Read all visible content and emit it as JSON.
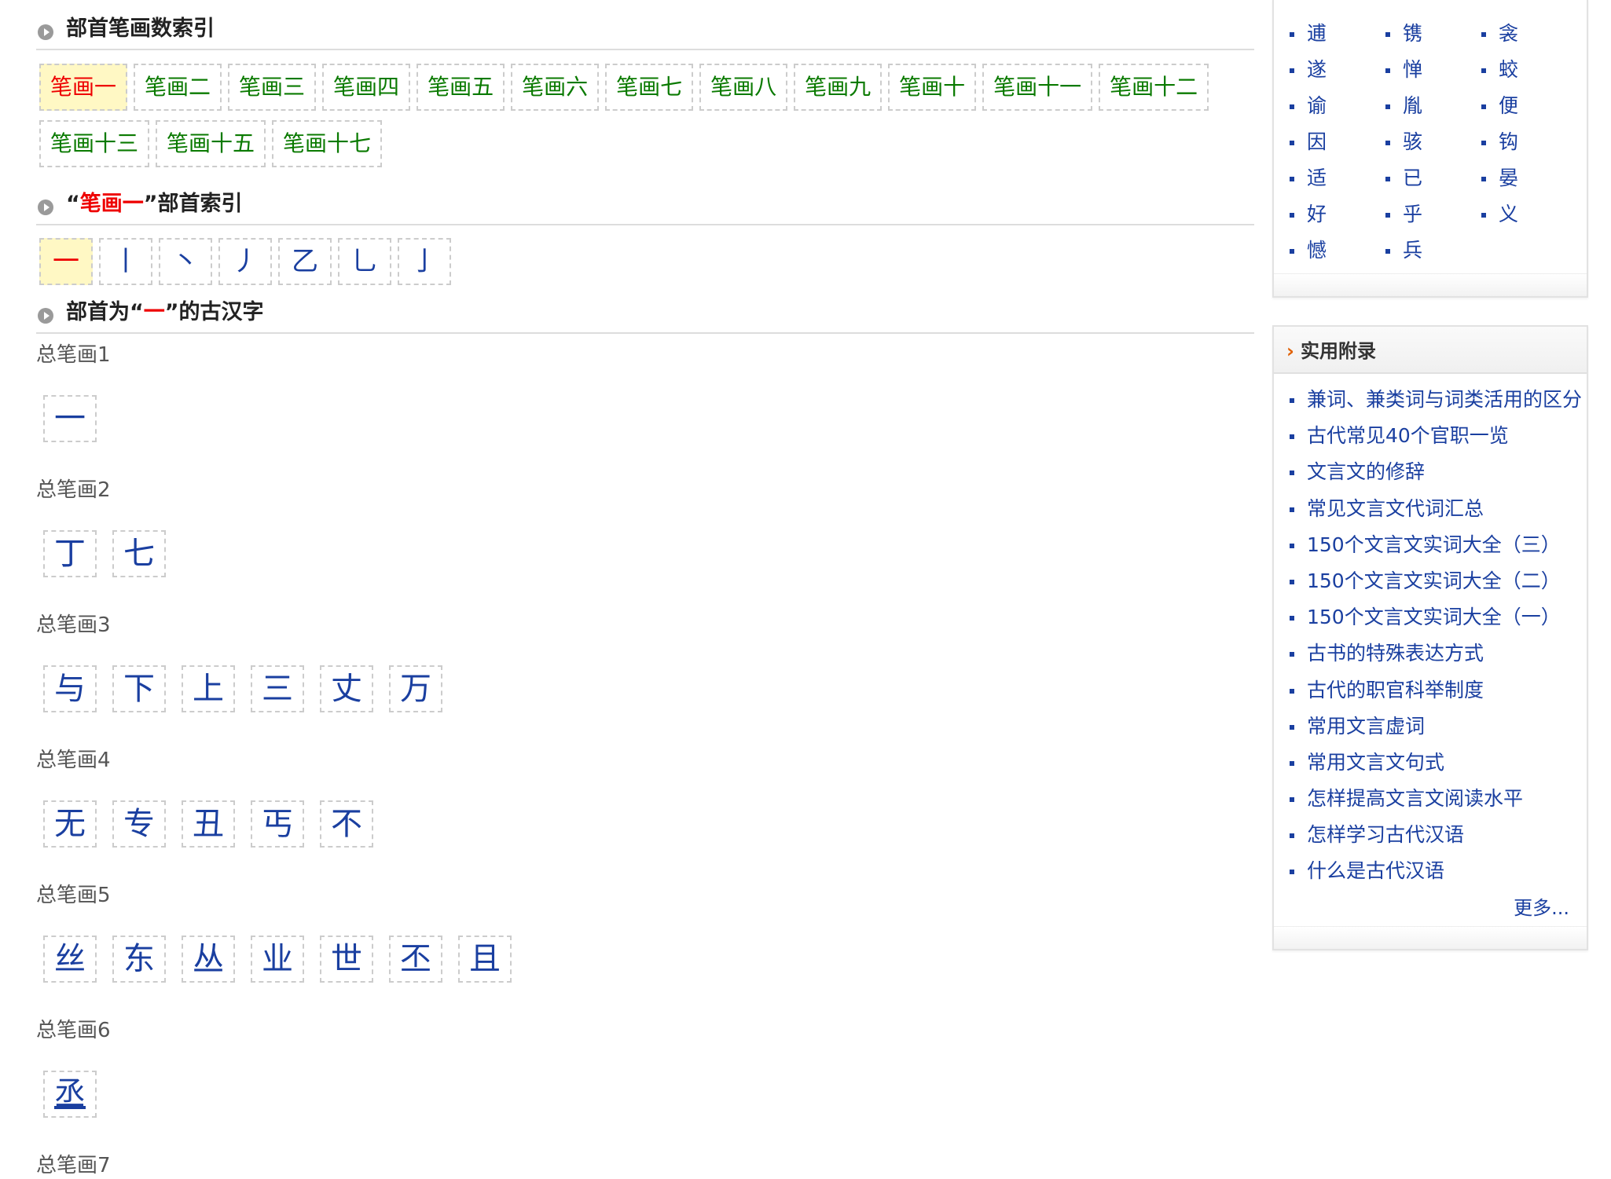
{
  "sections": {
    "stroke_index_title": "部首笔画数索引",
    "radical_index_title_pre": "“",
    "radical_index_title_red": "笔画一",
    "radical_index_title_post": "”部首索引",
    "chars_title_pre": "部首为“",
    "chars_title_red": "一",
    "chars_title_post": "”的古汉字"
  },
  "stroke_buttons": [
    "笔画一",
    "笔画二",
    "笔画三",
    "笔画四",
    "笔画五",
    "笔画六",
    "笔画七",
    "笔画八",
    "笔画九",
    "笔画十",
    "笔画十一",
    "笔画十二",
    "笔画十三",
    "笔画十五",
    "笔画十七"
  ],
  "radicals": [
    "一",
    "丨",
    "丶",
    "丿",
    "乙",
    "乚",
    "亅"
  ],
  "char_groups": [
    {
      "label": "总笔画1",
      "chars": [
        "一"
      ]
    },
    {
      "label": "总笔画2",
      "chars": [
        "丁",
        "七"
      ]
    },
    {
      "label": "总笔画3",
      "chars": [
        "与",
        "下",
        "上",
        "三",
        "丈",
        "万"
      ]
    },
    {
      "label": "总笔画4",
      "chars": [
        "无",
        "专",
        "丑",
        "丐",
        "不"
      ]
    },
    {
      "label": "总笔画5",
      "chars": [
        "丝",
        "东",
        "丛",
        "业",
        "世",
        "丕",
        "且"
      ]
    },
    {
      "label": "总笔画6",
      "chars": [
        "丞"
      ]
    },
    {
      "label": "总笔画7",
      "chars": []
    }
  ],
  "sidebar": {
    "word_grid": [
      [
        "逋",
        "镌",
        "衾"
      ],
      [
        "遂",
        "惮",
        "蛟"
      ],
      [
        "谕",
        "胤",
        "便"
      ],
      [
        "因",
        "骇",
        "钩"
      ],
      [
        "适",
        "已",
        "晏"
      ],
      [
        "好",
        "乎",
        "义"
      ],
      [
        "憾",
        "兵",
        ""
      ]
    ],
    "appendix_title": "实用附录",
    "appendix_links": [
      "兼词、兼类词与词类活用的区分",
      "古代常见40个官职一览",
      "文言文的修辞",
      "常见文言文代词汇总",
      "150个文言文实词大全（三）",
      "150个文言文实词大全（二）",
      "150个文言文实词大全（一）",
      "古书的特殊表达方式",
      "古代的职官科举制度",
      "常用文言虚词",
      "常用文言文句式",
      "怎样提高文言文阅读水平",
      "怎样学习古代汉语",
      "什么是古代汉语"
    ],
    "more_label": "更多..."
  },
  "colors": {
    "link": "#1a3fa0",
    "active_bg": "#fff8c4",
    "red": "#ee0000",
    "green": "#0a7a00"
  }
}
